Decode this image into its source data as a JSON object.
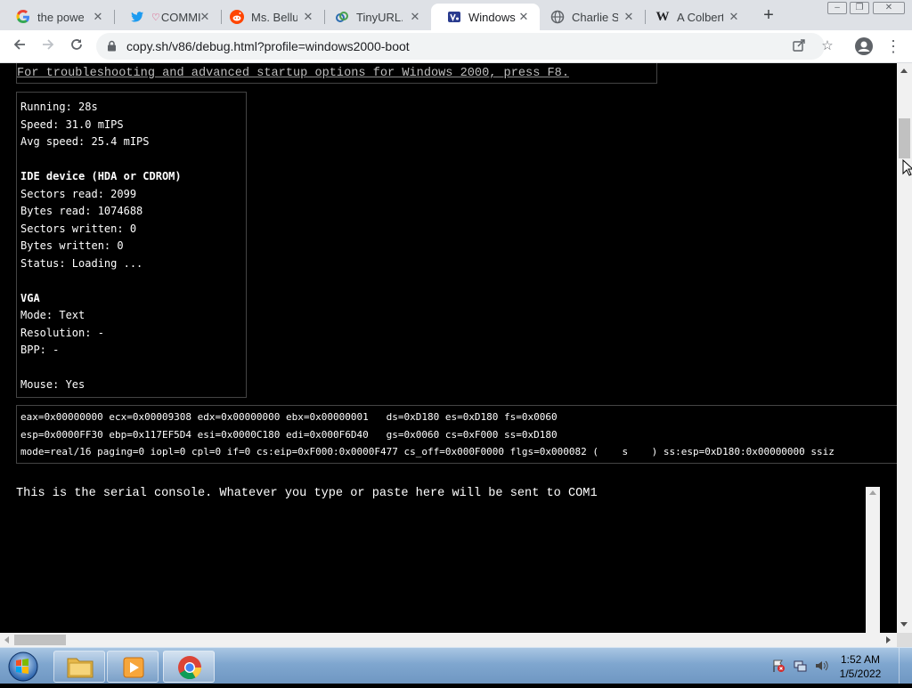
{
  "browser": {
    "tabs": [
      {
        "title": "the power",
        "favicon": "google-icon"
      },
      {
        "title": "COMMI",
        "favicon": "twitter-icon"
      },
      {
        "title": "Ms. Bellum",
        "favicon": "reddit-icon"
      },
      {
        "title": "TinyURL.c",
        "favicon": "tinyurl-icon"
      },
      {
        "title": "Windows",
        "favicon": "v86-icon",
        "active": true
      },
      {
        "title": "Charlie Sc",
        "favicon": "globe-icon"
      },
      {
        "title": "A Colbert",
        "favicon": "wikipedia-icon"
      }
    ],
    "url": "copy.sh/v86/debug.html?profile=windows2000-boot"
  },
  "page": {
    "boot_message": "For troubleshooting and advanced startup options for Windows 2000, press F8.",
    "stats": {
      "running": "Running: 28s",
      "speed": "Speed: 31.0 mIPS",
      "avg_speed": "Avg speed: 25.4 mIPS",
      "ide_header": "IDE device (HDA or CDROM)",
      "sectors_read": "Sectors read: 2099",
      "bytes_read": "Bytes read: 1074688",
      "sectors_written": "Sectors written: 0",
      "bytes_written": "Bytes written: 0",
      "status": "Status: Loading ...",
      "vga_header": "VGA",
      "mode": "Mode: Text",
      "resolution": "Resolution: -",
      "bpp": "BPP: -",
      "mouse": "Mouse: Yes"
    },
    "registers": [
      "eax=0x00000000 ecx=0x00009308 edx=0x00000000 ebx=0x00000001   ds=0xD180 es=0xD180 fs=0x0060",
      "esp=0x0000FF30 ebp=0x117EF5D4 esi=0x0000C180 edi=0x000F6D40   gs=0x0060 cs=0xF000 ss=0xD180",
      "mode=real/16 paging=0 iopl=0 cpl=0 if=0 cs:eip=0xF000:0x0000F477 cs_off=0x000F0000 flgs=0x000082 (    s    ) ss:esp=0xD180:0x00000000 ssiz"
    ],
    "serial_text": "This is the serial console. Whatever you type or paste here will be sent to COM1"
  },
  "taskbar": {
    "time": "1:52 AM",
    "date": "1/5/2022",
    "pinned": [
      "explorer-icon",
      "media-player-icon",
      "chrome-icon"
    ]
  },
  "colors": {
    "page_bg": "#000000",
    "tabstrip_bg": "#dee1e6",
    "taskbar_accent": "#7fa6cf"
  }
}
